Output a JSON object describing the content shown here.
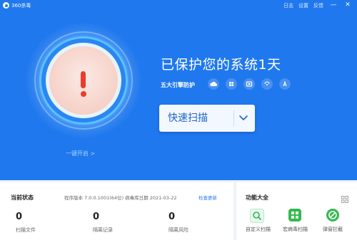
{
  "window": {
    "title": "360杀毒",
    "links": [
      "日志",
      "设置",
      "反馈"
    ],
    "controls": [
      "—",
      "✕"
    ]
  },
  "hero": {
    "status_headline": "已保护您的系统1天",
    "engines_label": "五大引擎防护",
    "engine_icons": [
      "cloud-icon",
      "windows-icon",
      "qvm-icon",
      "system-repair-icon",
      "avira-icon"
    ],
    "one_click_label": "一键开启 >"
  },
  "scan_button": {
    "label": "快速扫描"
  },
  "status_panel": {
    "title": "当前状态",
    "version_info": "程序版本 7.0.0.1001(64位)    病毒库日期 2021-03-22",
    "check_update": "检查更新",
    "stats": [
      {
        "value": "0",
        "label": "扫描文件"
      },
      {
        "value": "0",
        "label": "隔离记录"
      },
      {
        "value": "0",
        "label": "隔离风险"
      }
    ]
  },
  "features_panel": {
    "title": "功能大全",
    "items": [
      {
        "label": "自定义扫描",
        "icon": "custom-scan-icon"
      },
      {
        "label": "宏病毒扫描",
        "icon": "macro-virus-icon"
      },
      {
        "label": "弹窗拦截",
        "icon": "popup-block-icon"
      }
    ]
  },
  "colors": {
    "brand_blue": "#1f78ee",
    "alert_red": "#ea3b2c",
    "scan_text": "#1f64c8",
    "link_blue": "#2a7ae2",
    "feature_green": "#2db84d"
  }
}
